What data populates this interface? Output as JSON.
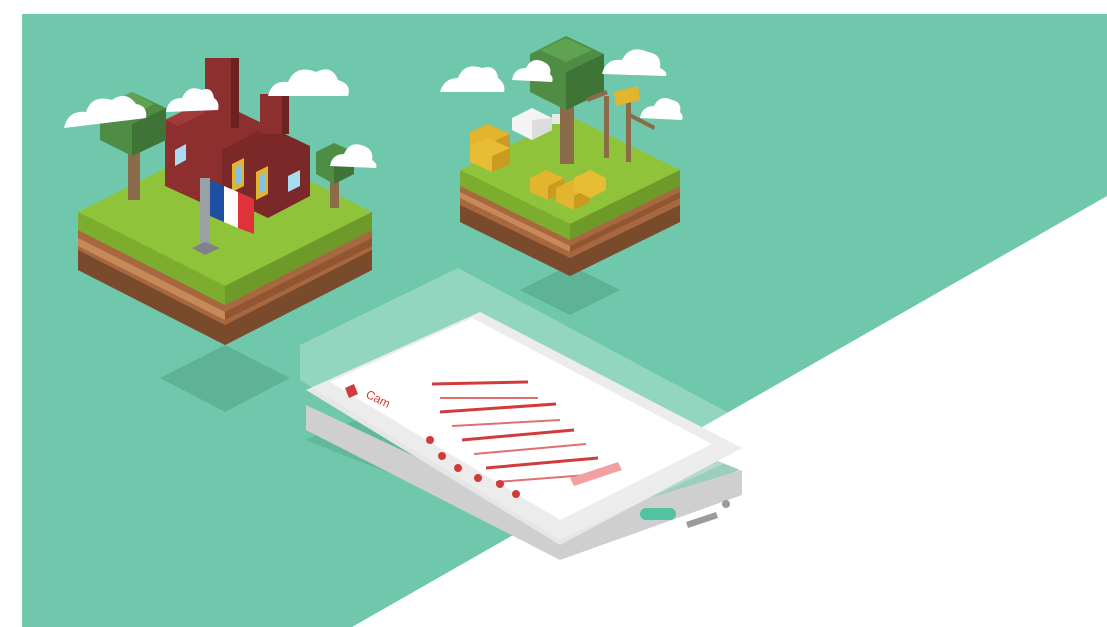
{
  "scene": {
    "colors": {
      "background_teal": "#6fc8ab",
      "background_white": "#ffffff",
      "grass": "#8fc43a",
      "soil": "#a7683f",
      "soil_dark": "#7a4a2c",
      "brick": "#8e2f2f",
      "tree_leaves": "#4f8d44",
      "tree_trunk": "#8a6b4a",
      "hay": "#e3b42d",
      "phone_body": "#e6e6e6",
      "phone_screen": "#ffffff",
      "app_accent": "#d23b3b",
      "home_button": "#52c3a0"
    },
    "phone": {
      "app_title": "Cam"
    },
    "icons": [
      "cloud-icon",
      "tree-icon",
      "factory-icon",
      "french-flag-icon",
      "hay-bale-icon",
      "sheep-icon",
      "smartphone-icon"
    ]
  }
}
